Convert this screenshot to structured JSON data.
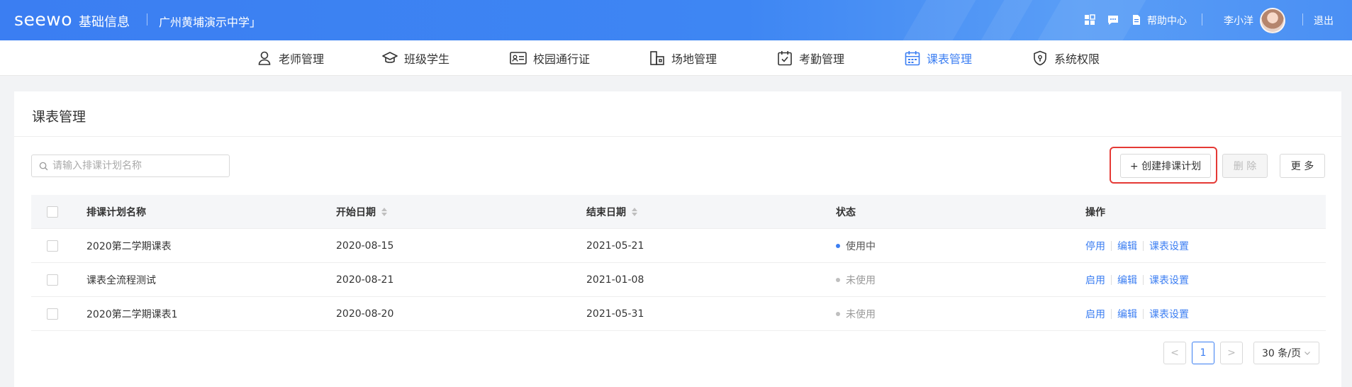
{
  "header": {
    "logo": "seewo",
    "app_name": "基础信息",
    "school": "广州黄埔演示中学」",
    "help": "帮助中心",
    "user": "李小洋",
    "logout": "退出",
    "icons": [
      "grid-icon",
      "message-icon",
      "document-icon"
    ]
  },
  "nav": {
    "items": [
      {
        "label": "老师管理",
        "icon": "teacher-icon"
      },
      {
        "label": "班级学生",
        "icon": "graduation-cap-icon"
      },
      {
        "label": "校园通行证",
        "icon": "id-card-icon"
      },
      {
        "label": "场地管理",
        "icon": "building-icon"
      },
      {
        "label": "考勤管理",
        "icon": "attendance-icon"
      },
      {
        "label": "课表管理",
        "icon": "calendar-icon"
      },
      {
        "label": "系统权限",
        "icon": "shield-icon"
      }
    ],
    "active_index": 5,
    "active_color": "#3b7ef2"
  },
  "page": {
    "title": "课表管理",
    "search_placeholder": "请输入排课计划名称",
    "create_button": "+ 创建排课计划",
    "delete_button": "删 除",
    "more_button": "更 多"
  },
  "table": {
    "columns": [
      "排课计划名称",
      "开始日期",
      "结束日期",
      "状态",
      "操作"
    ],
    "rows": [
      {
        "name": "2020第二学期课表",
        "start": "2020-08-15",
        "end": "2021-05-21",
        "status": "使用中",
        "active": true,
        "toggle": "停用",
        "edit": "编辑",
        "settings": "课表设置"
      },
      {
        "name": "课表全流程测试",
        "start": "2020-08-21",
        "end": "2021-01-08",
        "status": "未使用",
        "active": false,
        "toggle": "启用",
        "edit": "编辑",
        "settings": "课表设置"
      },
      {
        "name": "2020第二学期课表1",
        "start": "2020-08-20",
        "end": "2021-05-31",
        "status": "未使用",
        "active": false,
        "toggle": "启用",
        "edit": "编辑",
        "settings": "课表设置"
      }
    ]
  },
  "pagination": {
    "prev": "<",
    "current": "1",
    "next": ">",
    "page_size": "30 条/页"
  },
  "colors": {
    "accent": "#3b7ef2",
    "highlight": "#e53935",
    "status_on": "#3b7ef2",
    "status_off": "#bfbfbf"
  }
}
